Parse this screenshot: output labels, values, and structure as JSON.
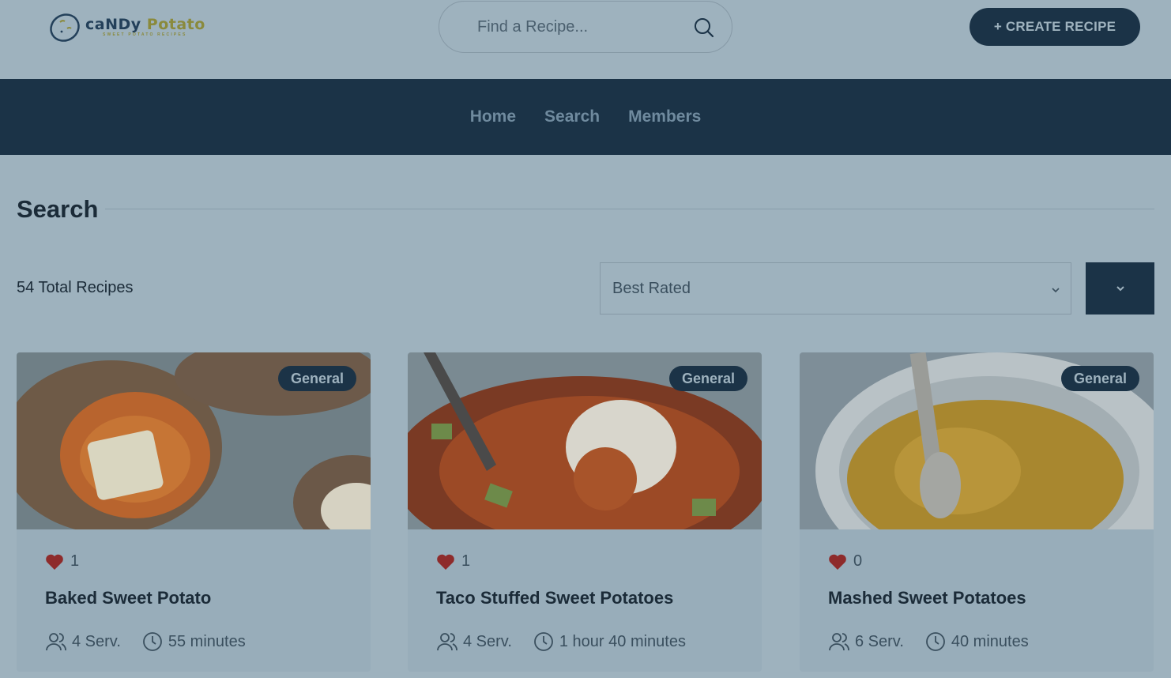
{
  "brand": {
    "name_part1": "caNDy",
    "name_part2": "Potato",
    "tagline": "SWEET POTATO RECIPES"
  },
  "search": {
    "placeholder": "Find a Recipe..."
  },
  "header": {
    "create_label": "+ CREATE RECIPE"
  },
  "nav": {
    "items": [
      {
        "label": "Home"
      },
      {
        "label": "Search"
      },
      {
        "label": "Members"
      }
    ]
  },
  "page": {
    "title": "Search",
    "total": "54 Total Recipes"
  },
  "sort": {
    "selected": "Best Rated"
  },
  "recipes": [
    {
      "category": "General",
      "likes": "1",
      "title": "Baked Sweet Potato",
      "servings": "4 Serv.",
      "time": "55 minutes"
    },
    {
      "category": "General",
      "likes": "1",
      "title": "Taco Stuffed Sweet Potatoes",
      "servings": "4 Serv.",
      "time": "1 hour 40 minutes"
    },
    {
      "category": "General",
      "likes": "0",
      "title": "Mashed Sweet Potatoes",
      "servings": "6 Serv.",
      "time": "40 minutes"
    }
  ],
  "colors": {
    "navy": "#1b3347",
    "overlay_bg": "#9eb2be",
    "heart": "#8e2b2b",
    "logo_olive": "#8a8a3c"
  },
  "icons": [
    "logo-potato-icon",
    "search-icon",
    "chevron-down-icon",
    "heart-icon",
    "users-icon",
    "clock-icon"
  ]
}
